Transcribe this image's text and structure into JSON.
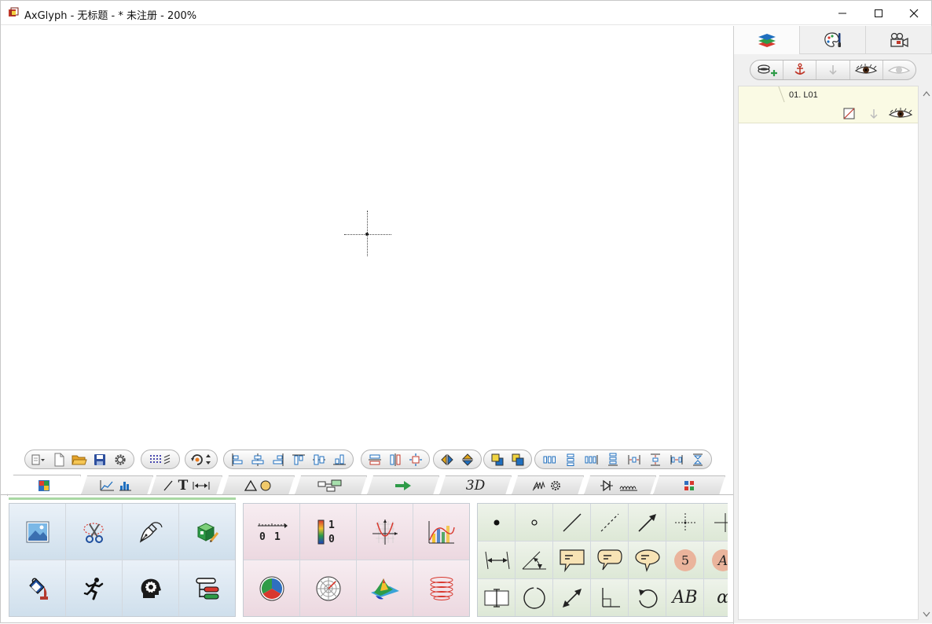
{
  "window": {
    "title": "AxGlyph - 无标题 - * 未注册 - 200%",
    "minimize": "—",
    "maximize": "☐",
    "close": "✕"
  },
  "right_panel": {
    "tabs": [
      {
        "icon": "layers-icon",
        "active": true
      },
      {
        "icon": "palette-icon",
        "active": false
      },
      {
        "icon": "camera-icon",
        "active": false
      }
    ],
    "layer_toolbar": [
      "add-layer-icon",
      "anchor-icon",
      "down-arrow-icon",
      "eye-icon",
      "eye-faded-icon"
    ],
    "layers": [
      {
        "name": "01. L01"
      }
    ]
  },
  "toolbar": {
    "groups": [
      {
        "name": "file",
        "buttons": [
          "new-menu-icon",
          "new-document-icon",
          "open-folder-icon",
          "save-icon",
          "settings-icon"
        ]
      },
      {
        "name": "grid",
        "buttons": [
          "grid-icon"
        ]
      },
      {
        "name": "rotate",
        "buttons": [
          "rotate-icon"
        ]
      },
      {
        "name": "align",
        "buttons": [
          "align-left-icon",
          "align-center-icon",
          "align-right-icon",
          "align-top-icon",
          "align-middle-icon",
          "align-bottom-icon"
        ]
      },
      {
        "name": "size",
        "buttons": [
          "same-width-icon",
          "same-height-icon",
          "same-size-icon"
        ]
      },
      {
        "name": "flip",
        "buttons": [
          "flip-horizontal-icon",
          "flip-vertical-icon"
        ]
      },
      {
        "name": "order",
        "buttons": [
          "bring-front-icon",
          "send-back-icon"
        ]
      },
      {
        "name": "distribute",
        "buttons": [
          "distribute-h-icon",
          "distribute-v-icon",
          "distribute-h2-icon",
          "distribute-v2-icon",
          "space-h-icon",
          "space-v-icon",
          "space-h2-icon",
          "space-v2-icon"
        ]
      }
    ]
  },
  "categories": [
    {
      "label": "",
      "icon": "image-category-icon",
      "active": true
    },
    {
      "label": "",
      "icon": "chart-category-icon"
    },
    {
      "label": "T",
      "icon": "line-text-category-icon"
    },
    {
      "label": "",
      "icon": "shapes-category-icon"
    },
    {
      "label": "",
      "icon": "flowchart-category-icon"
    },
    {
      "label": "",
      "icon": "arrow-category-icon"
    },
    {
      "label": "3D",
      "icon": "3d-category-icon"
    },
    {
      "label": "",
      "icon": "physics-category-icon"
    },
    {
      "label": "",
      "icon": "circuit-category-icon"
    },
    {
      "label": "",
      "icon": "more-category-icon"
    }
  ],
  "palette_left": [
    "image-icon",
    "scissors-icon",
    "pen-nib-icon",
    "cube-pencil-icon",
    "paint-bucket-icon",
    "runner-icon",
    "head-gear-icon",
    "hierarchy-icon"
  ],
  "palette_middle": {
    "axis_numbers": [
      "0",
      "1"
    ],
    "colorbar_numbers": [
      "1",
      "0"
    ],
    "icons": [
      "axis-ruler-icon",
      "color-bar-icon",
      "function-graph-icon",
      "area-chart-icon",
      "pie-chart-icon",
      "polar-chart-icon",
      "surface-3d-icon",
      "helix-icon"
    ]
  },
  "palette_right": {
    "circle_number": "5",
    "text_sample": "AB",
    "alpha_sample": "α",
    "partial_letter": "A",
    "icons": [
      "dot-icon",
      "small-circle-icon",
      "line-icon",
      "dashed-line-icon",
      "arrow-line-icon",
      "crosshair-icon",
      "corner-cross-icon",
      "dimension-arrow-icon",
      "angle-icon",
      "callout-rect-icon",
      "callout-round-icon",
      "callout-cloud-icon",
      "numbered-circle-icon",
      "letter-circle-icon",
      "text-box-icon",
      "dashed-circle-icon",
      "double-arrow-icon",
      "right-angle-icon",
      "rotate-arrow-icon",
      "text-ab-icon",
      "greek-text-icon"
    ]
  },
  "colors": {
    "accent_green": "#a9d8a3",
    "layer_row_bg": "#fafae4"
  }
}
